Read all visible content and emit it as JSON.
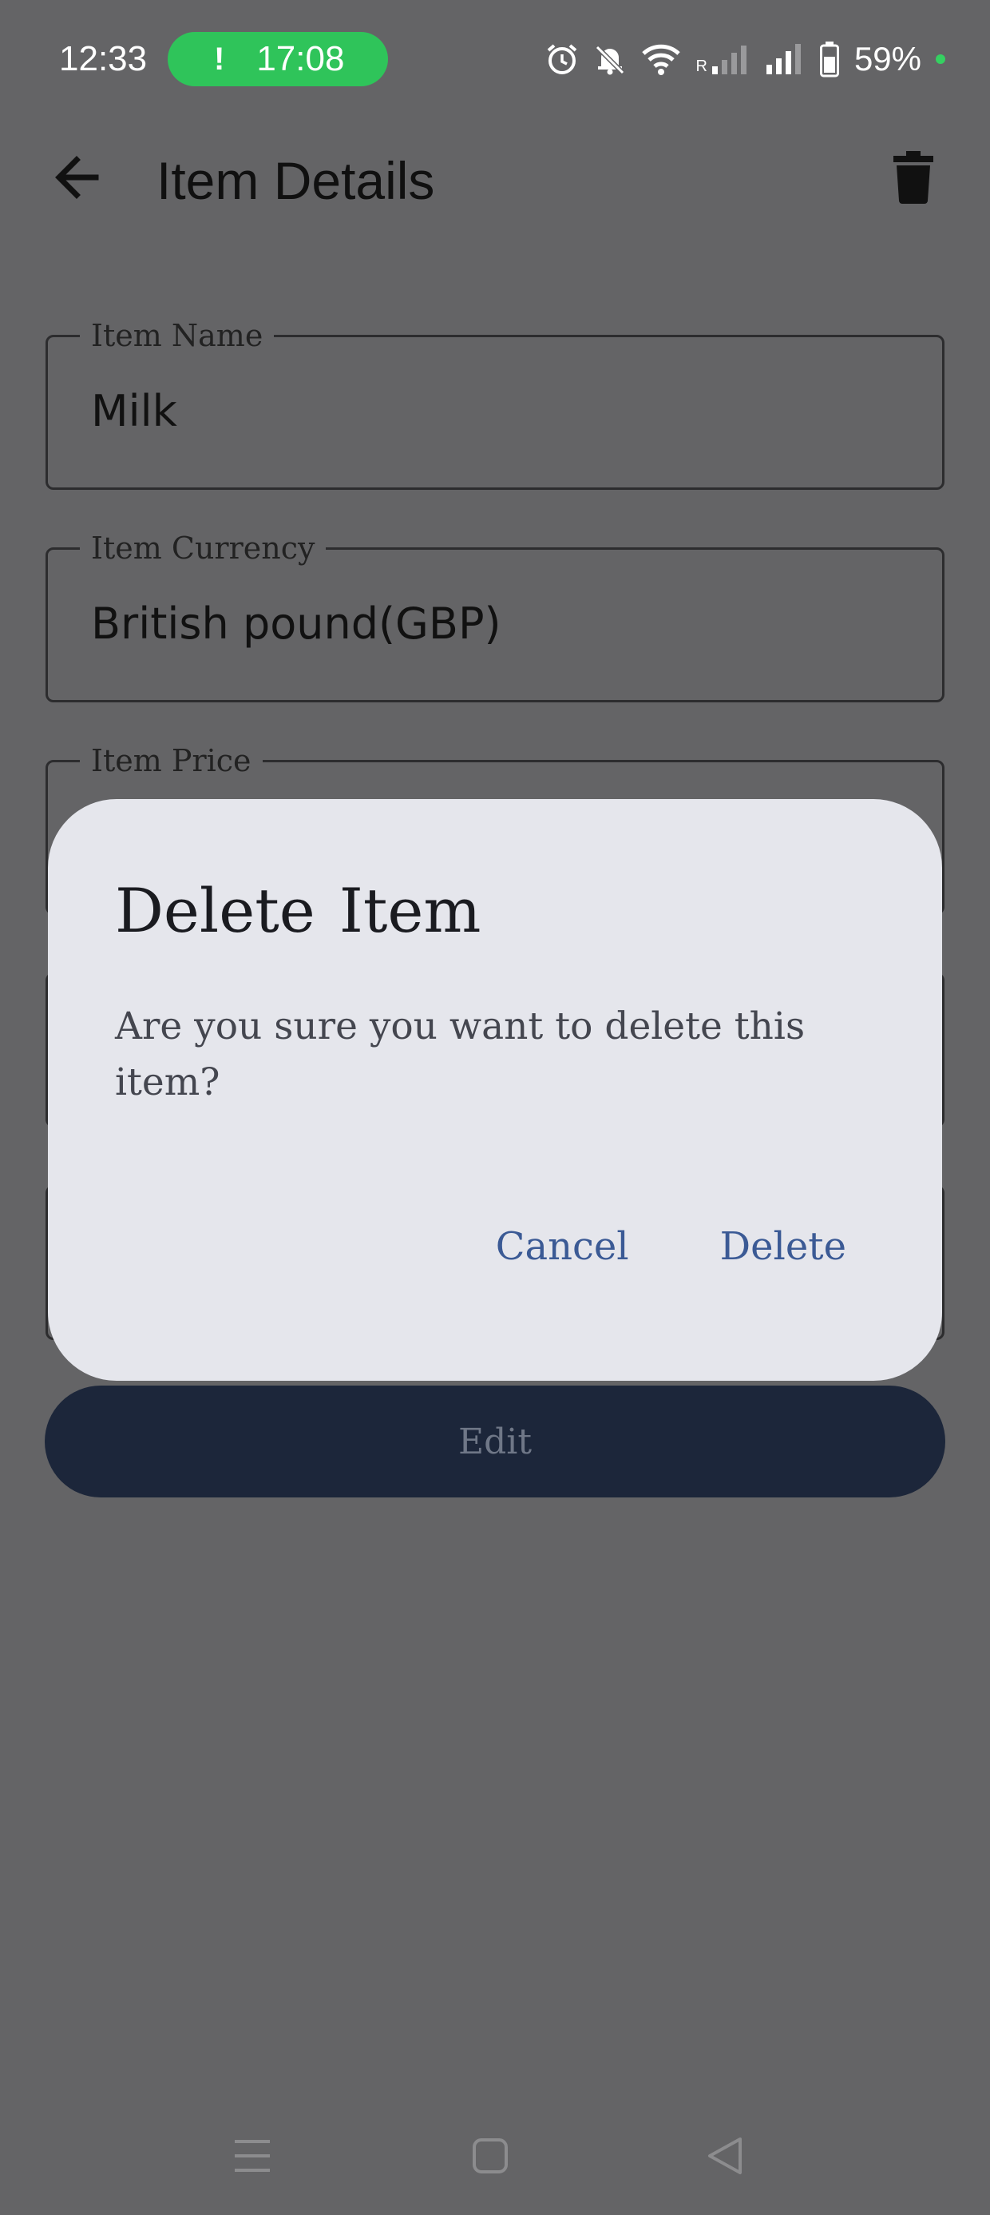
{
  "status_bar": {
    "time": "12:33",
    "call_indicator_icon": "!",
    "call_duration": "17:08",
    "battery_percent": "59%",
    "icons": [
      "alarm-icon",
      "bell-off-icon",
      "wifi-icon",
      "signal-roaming-icon",
      "signal-icon",
      "battery-icon"
    ],
    "roaming_label": "R"
  },
  "app_bar": {
    "title": "Item Details",
    "back_icon": "arrow-left-icon",
    "delete_icon": "trash-icon"
  },
  "form": {
    "item_name": {
      "label": "Item Name",
      "value": "Milk"
    },
    "item_currency": {
      "label": "Item Currency",
      "value": "British pound(GBP)"
    },
    "item_price": {
      "label": "Item Price",
      "value": ""
    }
  },
  "edit_button": {
    "label": "Edit"
  },
  "dialog": {
    "title": "Delete  Item",
    "message": "Are you sure you want to delete this item?",
    "cancel_label": "Cancel",
    "delete_label": "Delete"
  },
  "nav_bar": {
    "icons": [
      "menu-icon",
      "home-square-icon",
      "back-triangle-icon"
    ]
  },
  "colors": {
    "scrim_background": "#646466",
    "dialog_background": "#e5e6ec",
    "dialog_action": "#3b5a95",
    "edit_button": "#1c263a",
    "call_pill": "#2fc45a"
  }
}
